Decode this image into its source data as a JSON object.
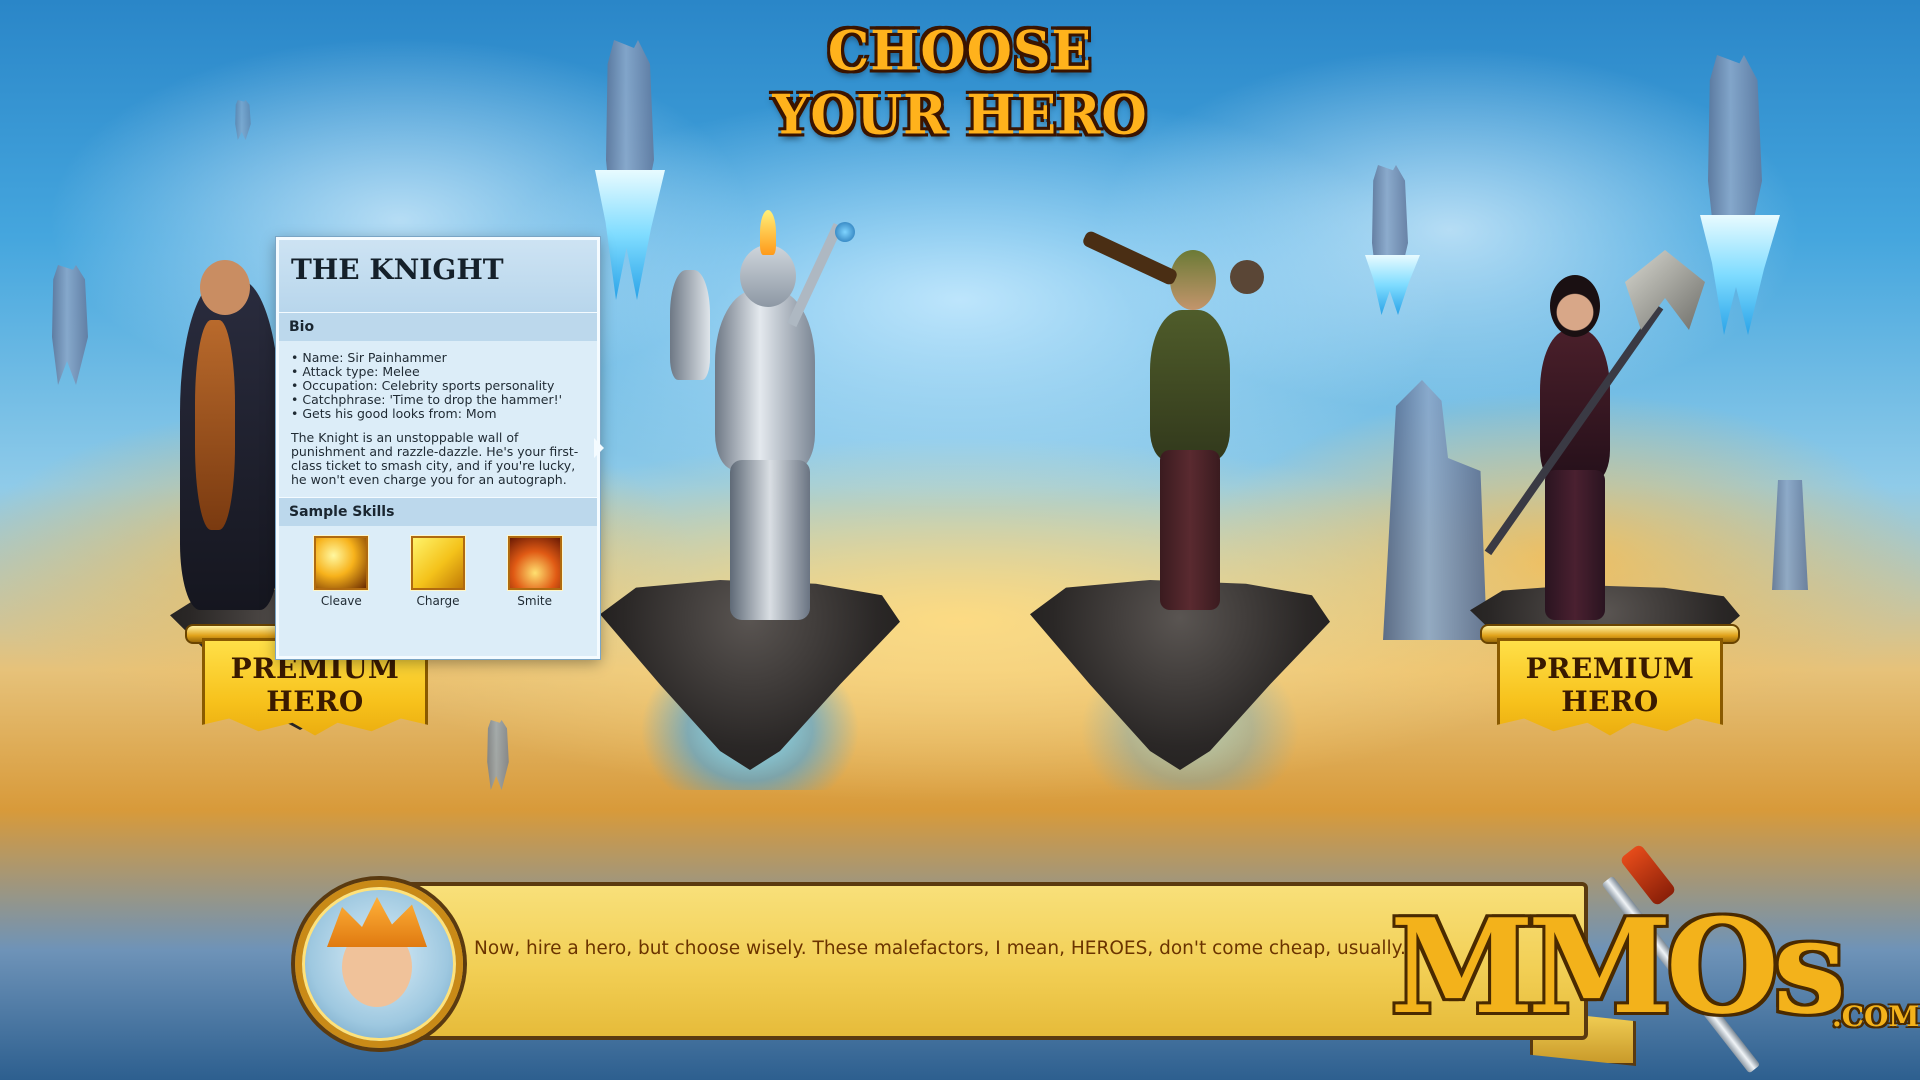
{
  "screen": {
    "title": "CHOOSE YOUR HERO"
  },
  "heroes": [
    {
      "slot": "left",
      "badge": "PREMIUM HERO"
    },
    {
      "slot": "knight"
    },
    {
      "slot": "ranger"
    },
    {
      "slot": "right",
      "badge": "PREMIUM HERO"
    }
  ],
  "info_panel": {
    "title": "THE KNIGHT",
    "bio_heading": "Bio",
    "bio_items": [
      "• Name: Sir Painhammer",
      "• Attack type: Melee",
      "• Occupation: Celebrity sports personality",
      "• Catchphrase: 'Time to drop the hammer!'",
      "• Gets his good looks from: Mom"
    ],
    "description": "The Knight is an unstoppable wall of punishment and razzle-dazzle. He's your first-class ticket to smash city, and if you're lucky, he won't even charge you for an autograph.",
    "skills_heading": "Sample Skills",
    "skills": [
      {
        "label": "Cleave",
        "icon": "cleave-icon"
      },
      {
        "label": "Charge",
        "icon": "charge-icon"
      },
      {
        "label": "Smite",
        "icon": "smite-icon"
      }
    ]
  },
  "dialog": {
    "text": "Now, hire a hero, but choose wisely. These malefactors, I mean, HEROES, don't come cheap, usually."
  },
  "watermark": {
    "logo": "MMOs",
    "suffix": ".COM"
  },
  "colors": {
    "title": "#ffb21c",
    "banner": "#f7c21c",
    "dialog_text": "#6b3400"
  }
}
